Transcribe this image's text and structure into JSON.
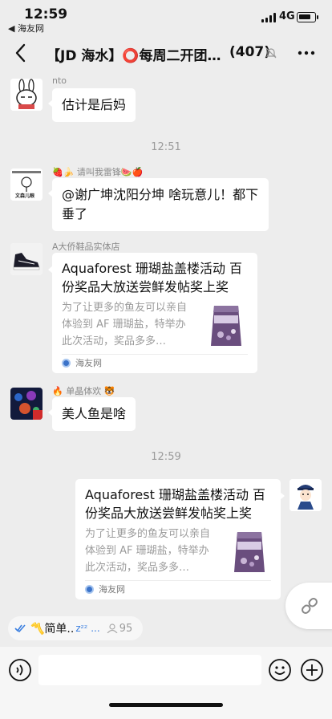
{
  "status_bar": {
    "time": "12:59",
    "back_app": "◀ 海友网",
    "network": "4G"
  },
  "header": {
    "title": "【JD 海水】⭕每周二开团…",
    "member_count": "(407)"
  },
  "messages": [
    {
      "type": "text",
      "side": "left",
      "sender": "nto",
      "text": "估计是后妈",
      "avatar_icon": "bunny-avatar"
    },
    {
      "type": "time",
      "text": "12:51"
    },
    {
      "type": "text",
      "side": "left",
      "sender": "🍓🍌 请叫我雷锋🍉🍎",
      "text": "@谢广坤沈阳分坤 啥玩意儿！都下垂了",
      "avatar_icon": "sticker-avatar",
      "avatar_caption": "文森儿眼"
    },
    {
      "type": "link",
      "side": "left",
      "sender": "A大侨鞋品实体店",
      "title": "Aquaforest 珊瑚盐盖楼活动 百份奖品大放送尝鲜发帖奖上奖",
      "desc": "为了让更多的鱼友可以亲自体验到 AF 珊瑚盐，特举办此次活动，奖品多多…",
      "source": "海友网",
      "avatar_icon": "sneaker-avatar"
    },
    {
      "type": "text",
      "side": "left",
      "sender": "🔥 单晶体欢 🐯",
      "text": "美人鱼是啥",
      "avatar_icon": "reef-avatar"
    },
    {
      "type": "time",
      "text": "12:59"
    },
    {
      "type": "link",
      "side": "right",
      "title": "Aquaforest 珊瑚盐盖楼活动 百份奖品大放送尝鲜发帖奖上奖",
      "desc": "为了让更多的鱼友可以亲自体验到 AF 珊瑚盐，特举办此次活动，奖品多多…",
      "source": "海友网",
      "avatar_icon": "police-cartoon-avatar"
    }
  ],
  "pinned": {
    "text": "〽️简单..",
    "sleep": "zᶻᶻ ...",
    "count": "95"
  },
  "colors": {
    "background": "#ededed",
    "bubble": "#ffffff",
    "link_dot": "#3b73c9",
    "muted_text": "#9b9b9b"
  }
}
